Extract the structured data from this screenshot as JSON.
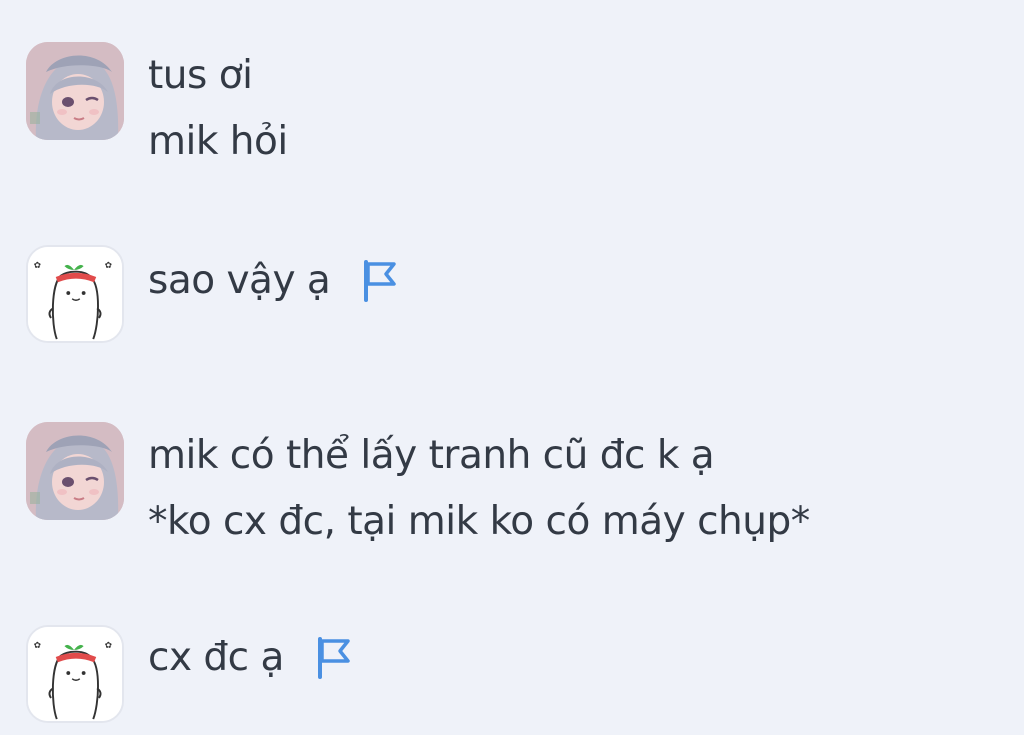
{
  "messages": [
    {
      "sender": "girl",
      "lines": [
        "tus ơi",
        "mik hỏi"
      ]
    },
    {
      "sender": "bunny",
      "lines": [
        "sao vậy ạ"
      ],
      "flag_icon": "flag-icon"
    },
    {
      "sender": "girl",
      "lines": [
        "mik có thể lấy tranh cũ đc k ạ",
        "*ko cx đc, tại mik ko có máy chụp*"
      ]
    },
    {
      "sender": "bunny",
      "lines": [
        "cx đc ạ"
      ],
      "flag_icon": "flag-icon"
    }
  ],
  "colors": {
    "background": "#eff2f9",
    "text": "#333a45",
    "flag": "#4a90e2"
  }
}
